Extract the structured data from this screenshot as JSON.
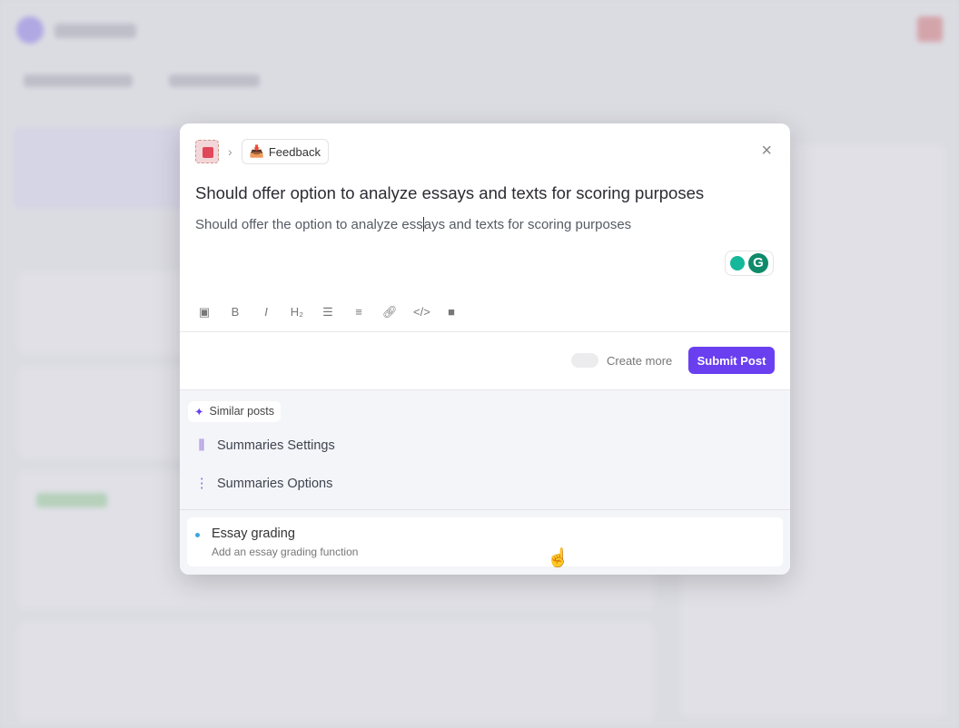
{
  "modal": {
    "breadcrumb": {
      "board_label": "Feedback"
    },
    "title": "Should offer option to analyze essays and texts for scoring purposes",
    "body_before_caret": "Should offer the option to analyze ess",
    "body_after_caret": "ays and texts for scoring purposes",
    "toolbar": [
      "image-icon",
      "bold-icon",
      "italic-icon",
      "heading-icon",
      "bullet-list-icon",
      "numbered-list-icon",
      "link-icon",
      "code-icon",
      "video-icon"
    ],
    "create_more_label": "Create more",
    "create_more_enabled": false,
    "submit_label": "Submit Post",
    "accent_color": "#6a3ff0",
    "similar_posts": {
      "label": "Similar posts",
      "items": [
        {
          "label": "Summaries Settings",
          "icon": "sliders-icon"
        },
        {
          "label": "Summaries Options",
          "icon": "dots-vertical-icon"
        }
      ],
      "suggestion": {
        "title": "Essay grading",
        "subtitle": "Add an essay grading function"
      }
    }
  }
}
